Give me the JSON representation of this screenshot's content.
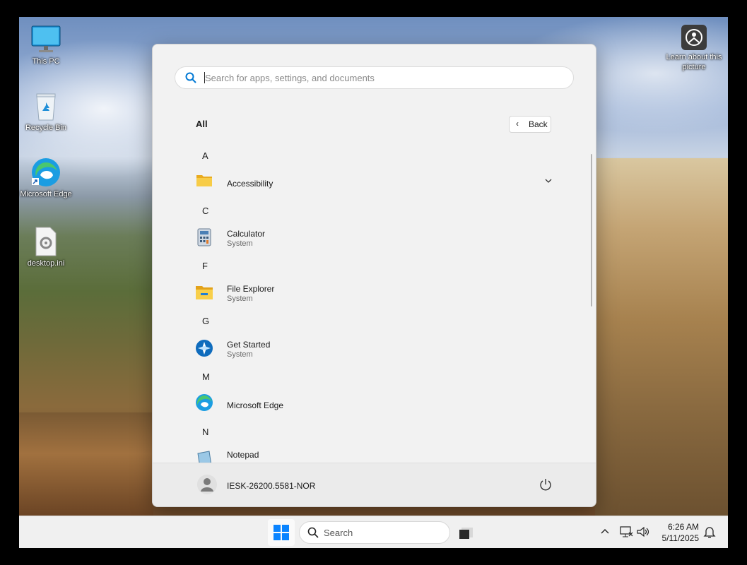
{
  "desktop": {
    "icons": [
      {
        "label": "This PC",
        "icon": "monitor-icon"
      },
      {
        "label": "Recycle Bin",
        "icon": "recycle-bin-icon"
      },
      {
        "label": "Microsoft Edge",
        "icon": "edge-icon"
      },
      {
        "label": "desktop.ini",
        "icon": "settings-file-icon"
      }
    ],
    "learn_about": {
      "label": "Learn about this picture",
      "icon": "camera-info-icon"
    }
  },
  "start_menu": {
    "search_placeholder": "Search for apps, settings, and documents",
    "all_label": "All",
    "back_label": "Back",
    "groups": [
      {
        "letter": "A",
        "apps": [
          {
            "name": "Accessibility",
            "subtitle": "",
            "icon": "folder-icon",
            "expandable": true
          }
        ]
      },
      {
        "letter": "C",
        "apps": [
          {
            "name": "Calculator",
            "subtitle": "System",
            "icon": "calculator-icon"
          }
        ]
      },
      {
        "letter": "F",
        "apps": [
          {
            "name": "File Explorer",
            "subtitle": "System",
            "icon": "file-explorer-icon"
          }
        ]
      },
      {
        "letter": "G",
        "apps": [
          {
            "name": "Get Started",
            "subtitle": "System",
            "icon": "get-started-icon"
          }
        ]
      },
      {
        "letter": "M",
        "apps": [
          {
            "name": "Microsoft Edge",
            "subtitle": "",
            "icon": "edge-icon"
          }
        ]
      },
      {
        "letter": "N",
        "apps": [
          {
            "name": "Notepad",
            "subtitle": "",
            "icon": "notepad-icon"
          }
        ]
      }
    ],
    "user_name": "IESK-26200.5581-NOR"
  },
  "taskbar": {
    "search_label": "Search",
    "time": "6:26 AM",
    "date": "5/11/2025"
  },
  "colors": {
    "accent": "#0078d4",
    "folder": "#f5c342"
  }
}
